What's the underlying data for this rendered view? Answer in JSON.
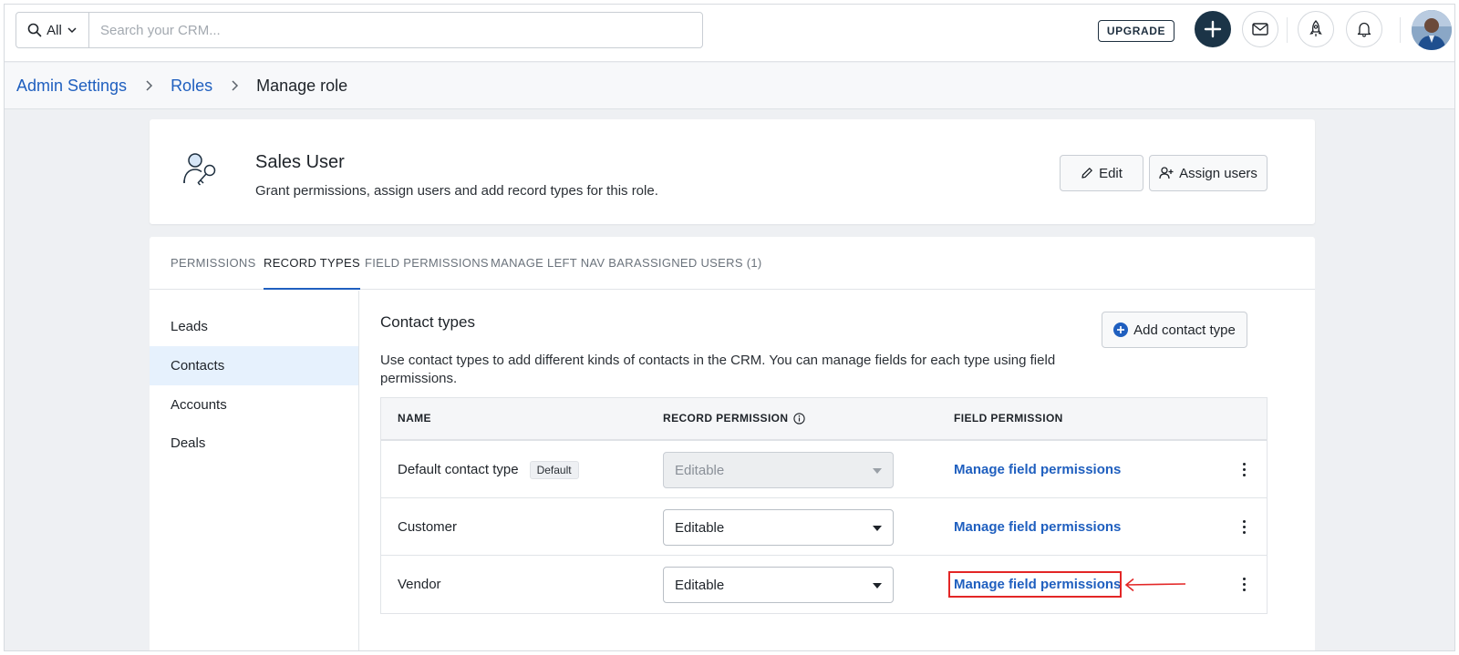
{
  "search": {
    "scope_label": "All",
    "placeholder": "Search your CRM...",
    "value": ""
  },
  "topbar": {
    "upgrade_label": "UPGRADE"
  },
  "breadcrumb": {
    "items": [
      "Admin Settings",
      "Roles"
    ],
    "current": "Manage role"
  },
  "role": {
    "title": "Sales User",
    "description": "Grant permissions, assign users and add record types for this role.",
    "edit_label": "Edit",
    "assign_label": "Assign users"
  },
  "tabs": [
    {
      "label": "PERMISSIONS",
      "active": false
    },
    {
      "label": "RECORD TYPES",
      "active": true
    },
    {
      "label": "FIELD PERMISSIONS",
      "active": false
    },
    {
      "label": "MANAGE LEFT NAV BAR",
      "active": false
    },
    {
      "label": "ASSIGNED USERS (1)",
      "active": false
    }
  ],
  "sidenav": [
    {
      "label": "Leads",
      "active": false
    },
    {
      "label": "Contacts",
      "active": true
    },
    {
      "label": "Accounts",
      "active": false
    },
    {
      "label": "Deals",
      "active": false
    }
  ],
  "content": {
    "title": "Contact types",
    "add_label": "Add contact type",
    "description": "Use contact types to add different kinds of contacts in the CRM. You can manage fields for each type using field permissions."
  },
  "table": {
    "headers": {
      "name": "NAME",
      "record_permission": "RECORD PERMISSION",
      "field_permission": "FIELD PERMISSION"
    },
    "rows": [
      {
        "name": "Default contact type",
        "badge": "Default",
        "permission": "Editable",
        "disabled": true,
        "link": "Manage field permissions"
      },
      {
        "name": "Customer",
        "badge": "",
        "permission": "Editable",
        "disabled": false,
        "link": "Manage field permissions"
      },
      {
        "name": "Vendor",
        "badge": "",
        "permission": "Editable",
        "disabled": false,
        "link": "Manage field permissions"
      }
    ]
  },
  "colors": {
    "accent": "#1f5fbf",
    "dark": "#1b3447",
    "annotation": "#e32626",
    "active_nav_bg": "#e6f1fd"
  }
}
